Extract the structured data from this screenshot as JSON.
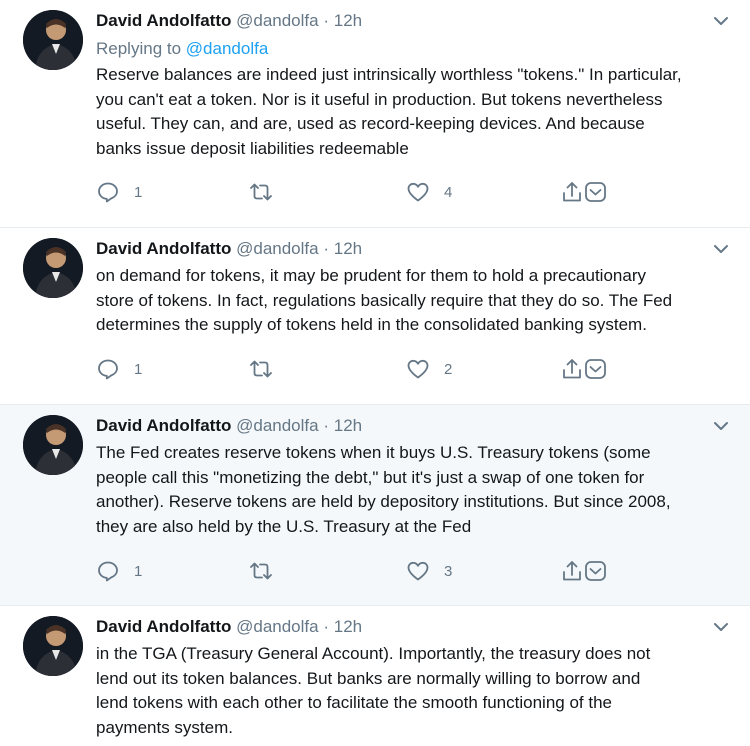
{
  "tweets": [
    {
      "author": "David Andolfatto",
      "handle": "@dandolfa",
      "separator": "·",
      "time": "12h",
      "replying_label": "Replying to",
      "replying_handle": "@dandolfa",
      "text": "Reserve balances are indeed just intrinsically worthless \"tokens.\" In particular,\nyou can't eat a token. Nor is it useful in production. But tokens nevertheless\nuseful. They can, and are, used as record-keeping devices. And because\nbanks issue deposit liabilities redeemable",
      "replies": "1",
      "retweets": "",
      "likes": "4"
    },
    {
      "author": "David Andolfatto",
      "handle": "@dandolfa",
      "separator": "·",
      "time": "12h",
      "text": "on demand for tokens, it may be prudent for them to hold a precautionary\nstore of tokens. In fact, regulations basically require that they do so. The Fed\ndetermines the supply of tokens held in the consolidated banking system.",
      "replies": "1",
      "retweets": "",
      "likes": "2"
    },
    {
      "author": "David Andolfatto",
      "handle": "@dandolfa",
      "separator": "·",
      "time": "12h",
      "text": "The Fed creates reserve tokens when it buys U.S. Treasury tokens (some\npeople call this \"monetizing the debt,\" but it's just a swap of one token for\nanother). Reserve tokens are held by depository institutions. But since 2008,\nthey are also held by the U.S. Treasury at the Fed",
      "replies": "1",
      "retweets": "",
      "likes": "3"
    },
    {
      "author": "David Andolfatto",
      "handle": "@dandolfa",
      "separator": "·",
      "time": "12h",
      "text": "in the TGA (Treasury General Account). Importantly, the treasury does not\nlend out its token balances. But banks are normally willing to borrow and\nlend tokens with each other to facilitate the smooth functioning of the\npayments system."
    }
  ],
  "colors": {
    "text": "#14171a",
    "muted": "#657786",
    "link": "#1da1f2",
    "highlight_bg": "#f5f8fa",
    "border": "#e6ecf0"
  },
  "icons": [
    "chevron-down-icon",
    "reply-icon",
    "retweet-icon",
    "like-icon",
    "share-icon",
    "dm-icon"
  ]
}
